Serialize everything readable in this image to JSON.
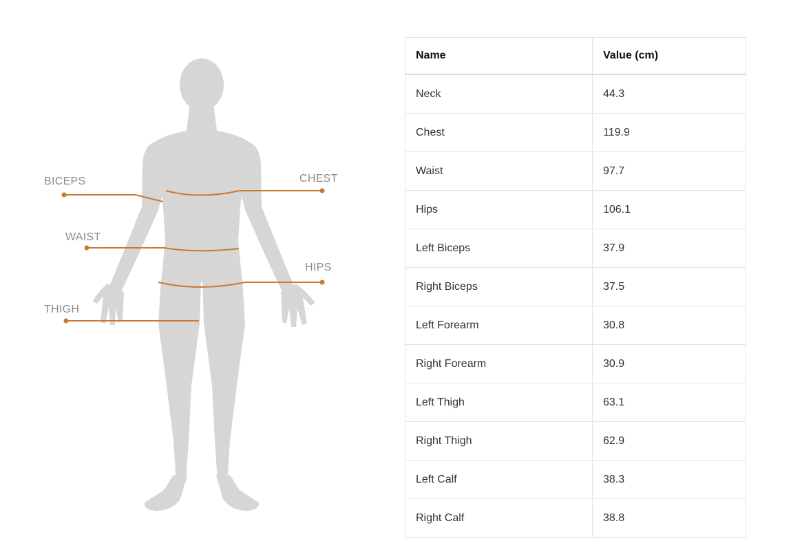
{
  "figure": {
    "body_color": "#d6d6d6",
    "accent_color": "#c87a32",
    "labels": {
      "biceps": "BICEPS",
      "chest": "CHEST",
      "waist": "WAIST",
      "hips": "HIPS",
      "thigh": "THIGH"
    }
  },
  "table": {
    "headers": {
      "name": "Name",
      "value": "Value (cm)"
    },
    "rows": [
      {
        "name": "Neck",
        "value": "44.3"
      },
      {
        "name": "Chest",
        "value": "119.9"
      },
      {
        "name": "Waist",
        "value": "97.7"
      },
      {
        "name": "Hips",
        "value": "106.1"
      },
      {
        "name": "Left Biceps",
        "value": "37.9"
      },
      {
        "name": "Right Biceps",
        "value": "37.5"
      },
      {
        "name": "Left Forearm",
        "value": "30.8"
      },
      {
        "name": "Right Forearm",
        "value": "30.9"
      },
      {
        "name": "Left Thigh",
        "value": "63.1"
      },
      {
        "name": "Right Thigh",
        "value": "62.9"
      },
      {
        "name": "Left Calf",
        "value": "38.3"
      },
      {
        "name": "Right Calf",
        "value": "38.8"
      }
    ]
  }
}
